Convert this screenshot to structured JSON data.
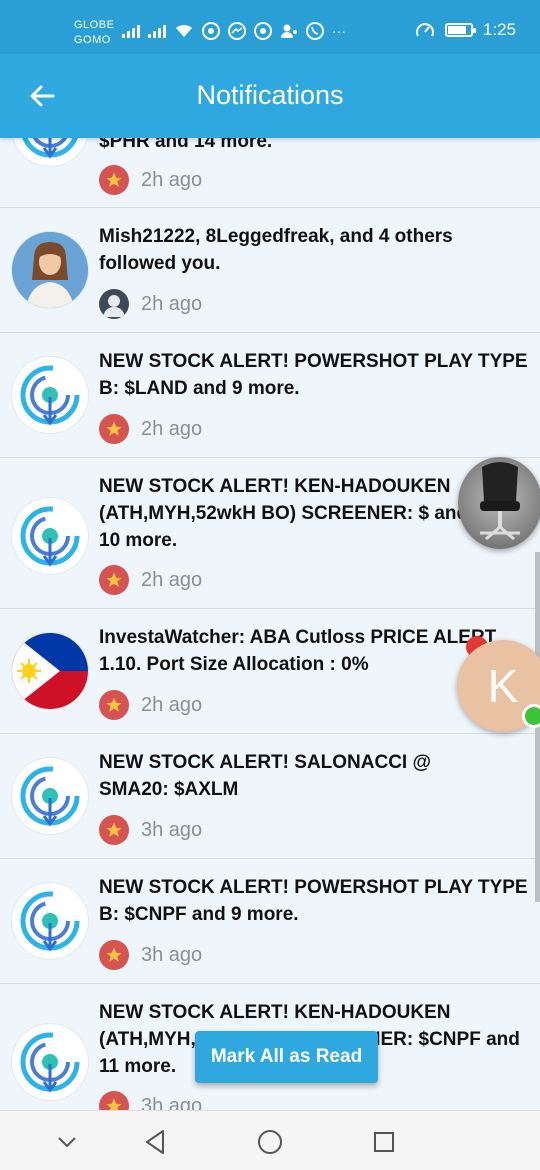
{
  "status_bar": {
    "carrier_line1": "GLOBE",
    "carrier_line2": "GOMO",
    "extra": "···",
    "time": "1:25"
  },
  "header": {
    "title": "Notifications"
  },
  "notifications": [
    {
      "text": "$PHR and 14 more.",
      "time": "2h ago",
      "avatar": "target-icon",
      "badge": "star-icon"
    },
    {
      "text": "Mish21222, 8Leggedfreak, and 4 others followed you.",
      "time": "2h ago",
      "avatar": "user-photo",
      "badge": "user-icon"
    },
    {
      "text": "NEW STOCK ALERT! POWERSHOT PLAY TYPE B: $LAND and 9 more.",
      "time": "2h ago",
      "avatar": "target-icon",
      "badge": "star-icon"
    },
    {
      "text": "NEW STOCK ALERT! KEN-HADOUKEN (ATH,MYH,52wkH BO) SCREENER: $ and 10 more.",
      "time": "2h ago",
      "avatar": "target-icon",
      "badge": "star-icon"
    },
    {
      "text": "InvestaWatcher: ABA Cutloss PRICE ALERT 1.10. Port Size Allocation : 0%",
      "time": "2h ago",
      "avatar": "philippine-flag-icon",
      "badge": "star-icon"
    },
    {
      "text": "NEW STOCK ALERT! SALONACCI @ SMA20: $AXLM",
      "time": "3h ago",
      "avatar": "target-icon",
      "badge": "star-icon"
    },
    {
      "text": "NEW STOCK ALERT! POWERSHOT PLAY TYPE B: $CNPF and 9 more.",
      "time": "3h ago",
      "avatar": "target-icon",
      "badge": "star-icon"
    },
    {
      "text": "NEW STOCK ALERT! KEN-HADOUKEN (ATH,MYH,52wkH BO) SCREENER: $CNPF and 11 more.",
      "time": "3h ago",
      "avatar": "target-icon",
      "badge": "star-icon"
    }
  ],
  "floating": {
    "chat_head_letter": "K",
    "unread_count": ""
  },
  "actions": {
    "mark_all_label": "Mark All as Read"
  },
  "colors": {
    "primary": "#2ea8df",
    "status_bar": "#2a9fd6",
    "star_badge": "#d55451",
    "background": "#eef5fb"
  }
}
